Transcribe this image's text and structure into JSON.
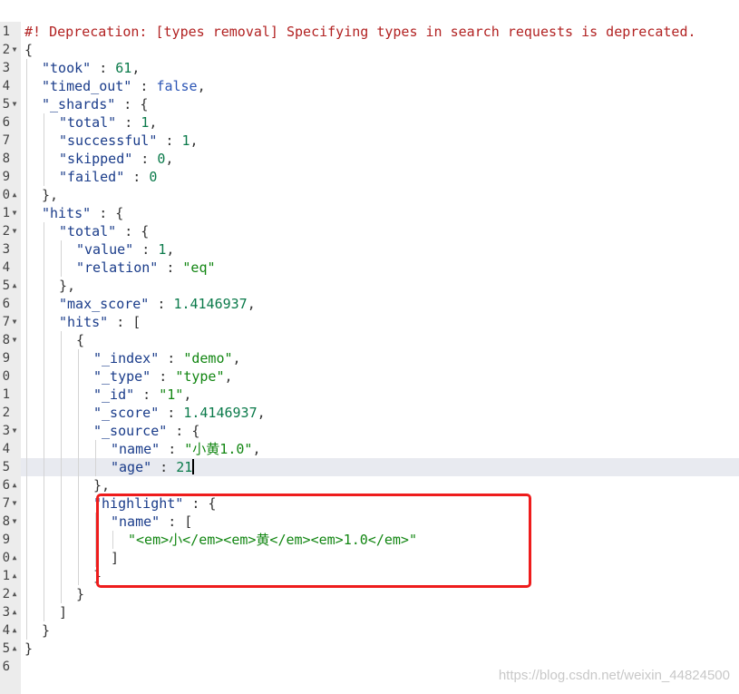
{
  "watermark": "https://blog.csdn.net/weixin_44824500",
  "colors": {
    "comment": "#b22222",
    "key": "#1a3c8a",
    "number": "#0a7a4a",
    "boolean": "#2c55b5",
    "string": "#128612",
    "annotation_border": "#ee1c1c",
    "active_line": "#e8eaf0"
  },
  "lines": [
    {
      "n": "1",
      "fold": "",
      "indent": 0,
      "active": false,
      "tokens": [
        {
          "t": "#! Deprecation: [types removal] Specifying types in search requests is deprecated.",
          "c": "comment"
        }
      ]
    },
    {
      "n": "2",
      "fold": "down",
      "indent": 0,
      "active": false,
      "tokens": [
        {
          "t": "{",
          "c": "punct"
        }
      ]
    },
    {
      "n": "3",
      "fold": "",
      "indent": 1,
      "active": false,
      "tokens": [
        {
          "t": "\"took\"",
          "c": "key"
        },
        {
          "t": " : ",
          "c": "punct"
        },
        {
          "t": "61",
          "c": "num"
        },
        {
          "t": ",",
          "c": "punct"
        }
      ]
    },
    {
      "n": "4",
      "fold": "",
      "indent": 1,
      "active": false,
      "tokens": [
        {
          "t": "\"timed_out\"",
          "c": "key"
        },
        {
          "t": " : ",
          "c": "punct"
        },
        {
          "t": "false",
          "c": "bool"
        },
        {
          "t": ",",
          "c": "punct"
        }
      ]
    },
    {
      "n": "5",
      "fold": "down",
      "indent": 1,
      "active": false,
      "tokens": [
        {
          "t": "\"_shards\"",
          "c": "key"
        },
        {
          "t": " : {",
          "c": "punct"
        }
      ]
    },
    {
      "n": "6",
      "fold": "",
      "indent": 2,
      "active": false,
      "tokens": [
        {
          "t": "\"total\"",
          "c": "key"
        },
        {
          "t": " : ",
          "c": "punct"
        },
        {
          "t": "1",
          "c": "num"
        },
        {
          "t": ",",
          "c": "punct"
        }
      ]
    },
    {
      "n": "7",
      "fold": "",
      "indent": 2,
      "active": false,
      "tokens": [
        {
          "t": "\"successful\"",
          "c": "key"
        },
        {
          "t": " : ",
          "c": "punct"
        },
        {
          "t": "1",
          "c": "num"
        },
        {
          "t": ",",
          "c": "punct"
        }
      ]
    },
    {
      "n": "8",
      "fold": "",
      "indent": 2,
      "active": false,
      "tokens": [
        {
          "t": "\"skipped\"",
          "c": "key"
        },
        {
          "t": " : ",
          "c": "punct"
        },
        {
          "t": "0",
          "c": "num"
        },
        {
          "t": ",",
          "c": "punct"
        }
      ]
    },
    {
      "n": "9",
      "fold": "",
      "indent": 2,
      "active": false,
      "tokens": [
        {
          "t": "\"failed\"",
          "c": "key"
        },
        {
          "t": " : ",
          "c": "punct"
        },
        {
          "t": "0",
          "c": "num"
        }
      ]
    },
    {
      "n": "0",
      "fold": "up",
      "indent": 1,
      "active": false,
      "tokens": [
        {
          "t": "},",
          "c": "punct"
        }
      ]
    },
    {
      "n": "1",
      "fold": "down",
      "indent": 1,
      "active": false,
      "tokens": [
        {
          "t": "\"hits\"",
          "c": "key"
        },
        {
          "t": " : {",
          "c": "punct"
        }
      ]
    },
    {
      "n": "2",
      "fold": "down",
      "indent": 2,
      "active": false,
      "tokens": [
        {
          "t": "\"total\"",
          "c": "key"
        },
        {
          "t": " : {",
          "c": "punct"
        }
      ]
    },
    {
      "n": "3",
      "fold": "",
      "indent": 3,
      "active": false,
      "tokens": [
        {
          "t": "\"value\"",
          "c": "key"
        },
        {
          "t": " : ",
          "c": "punct"
        },
        {
          "t": "1",
          "c": "num"
        },
        {
          "t": ",",
          "c": "punct"
        }
      ]
    },
    {
      "n": "4",
      "fold": "",
      "indent": 3,
      "active": false,
      "tokens": [
        {
          "t": "\"relation\"",
          "c": "key"
        },
        {
          "t": " : ",
          "c": "punct"
        },
        {
          "t": "\"eq\"",
          "c": "str"
        }
      ]
    },
    {
      "n": "5",
      "fold": "up",
      "indent": 2,
      "active": false,
      "tokens": [
        {
          "t": "},",
          "c": "punct"
        }
      ]
    },
    {
      "n": "6",
      "fold": "",
      "indent": 2,
      "active": false,
      "tokens": [
        {
          "t": "\"max_score\"",
          "c": "key"
        },
        {
          "t": " : ",
          "c": "punct"
        },
        {
          "t": "1.4146937",
          "c": "num"
        },
        {
          "t": ",",
          "c": "punct"
        }
      ]
    },
    {
      "n": "7",
      "fold": "down",
      "indent": 2,
      "active": false,
      "tokens": [
        {
          "t": "\"hits\"",
          "c": "key"
        },
        {
          "t": " : [",
          "c": "punct"
        }
      ]
    },
    {
      "n": "8",
      "fold": "down",
      "indent": 3,
      "active": false,
      "tokens": [
        {
          "t": "{",
          "c": "punct"
        }
      ]
    },
    {
      "n": "9",
      "fold": "",
      "indent": 4,
      "active": false,
      "tokens": [
        {
          "t": "\"_index\"",
          "c": "key"
        },
        {
          "t": " : ",
          "c": "punct"
        },
        {
          "t": "\"demo\"",
          "c": "str"
        },
        {
          "t": ",",
          "c": "punct"
        }
      ]
    },
    {
      "n": "0",
      "fold": "",
      "indent": 4,
      "active": false,
      "tokens": [
        {
          "t": "\"_type\"",
          "c": "key"
        },
        {
          "t": " : ",
          "c": "punct"
        },
        {
          "t": "\"type\"",
          "c": "str"
        },
        {
          "t": ",",
          "c": "punct"
        }
      ]
    },
    {
      "n": "1",
      "fold": "",
      "indent": 4,
      "active": false,
      "tokens": [
        {
          "t": "\"_id\"",
          "c": "key"
        },
        {
          "t": " : ",
          "c": "punct"
        },
        {
          "t": "\"1\"",
          "c": "str"
        },
        {
          "t": ",",
          "c": "punct"
        }
      ]
    },
    {
      "n": "2",
      "fold": "",
      "indent": 4,
      "active": false,
      "tokens": [
        {
          "t": "\"_score\"",
          "c": "key"
        },
        {
          "t": " : ",
          "c": "punct"
        },
        {
          "t": "1.4146937",
          "c": "num"
        },
        {
          "t": ",",
          "c": "punct"
        }
      ]
    },
    {
      "n": "3",
      "fold": "down",
      "indent": 4,
      "active": false,
      "tokens": [
        {
          "t": "\"_source\"",
          "c": "key"
        },
        {
          "t": " : {",
          "c": "punct"
        }
      ]
    },
    {
      "n": "4",
      "fold": "",
      "indent": 5,
      "active": false,
      "tokens": [
        {
          "t": "\"name\"",
          "c": "key"
        },
        {
          "t": " : ",
          "c": "punct"
        },
        {
          "t": "\"小黄1.0\"",
          "c": "str"
        },
        {
          "t": ",",
          "c": "punct"
        }
      ]
    },
    {
      "n": "5",
      "fold": "",
      "indent": 5,
      "active": true,
      "tokens": [
        {
          "t": "\"age\"",
          "c": "key"
        },
        {
          "t": " : ",
          "c": "punct"
        },
        {
          "t": "21",
          "c": "num"
        }
      ]
    },
    {
      "n": "6",
      "fold": "up",
      "indent": 4,
      "active": false,
      "tokens": [
        {
          "t": "},",
          "c": "punct"
        }
      ]
    },
    {
      "n": "7",
      "fold": "down",
      "indent": 4,
      "active": false,
      "tokens": [
        {
          "t": "\"highlight\"",
          "c": "key"
        },
        {
          "t": " : {",
          "c": "punct"
        }
      ]
    },
    {
      "n": "8",
      "fold": "down",
      "indent": 5,
      "active": false,
      "tokens": [
        {
          "t": "\"name\"",
          "c": "key"
        },
        {
          "t": " : [",
          "c": "punct"
        }
      ]
    },
    {
      "n": "9",
      "fold": "",
      "indent": 6,
      "active": false,
      "tokens": [
        {
          "t": "\"<em>小</em><em>黄</em><em>1.0</em>\"",
          "c": "str"
        }
      ]
    },
    {
      "n": "0",
      "fold": "up",
      "indent": 5,
      "active": false,
      "tokens": [
        {
          "t": "]",
          "c": "punct"
        }
      ]
    },
    {
      "n": "1",
      "fold": "up",
      "indent": 4,
      "active": false,
      "tokens": [
        {
          "t": "}",
          "c": "punct"
        }
      ]
    },
    {
      "n": "2",
      "fold": "up",
      "indent": 3,
      "active": false,
      "tokens": [
        {
          "t": "}",
          "c": "punct"
        }
      ]
    },
    {
      "n": "3",
      "fold": "up",
      "indent": 2,
      "active": false,
      "tokens": [
        {
          "t": "]",
          "c": "punct"
        }
      ]
    },
    {
      "n": "4",
      "fold": "up",
      "indent": 1,
      "active": false,
      "tokens": [
        {
          "t": "}",
          "c": "punct"
        }
      ]
    },
    {
      "n": "5",
      "fold": "up",
      "indent": 0,
      "active": false,
      "tokens": [
        {
          "t": "}",
          "c": "punct"
        }
      ]
    },
    {
      "n": "6",
      "fold": "",
      "indent": 0,
      "active": false,
      "tokens": []
    }
  ]
}
